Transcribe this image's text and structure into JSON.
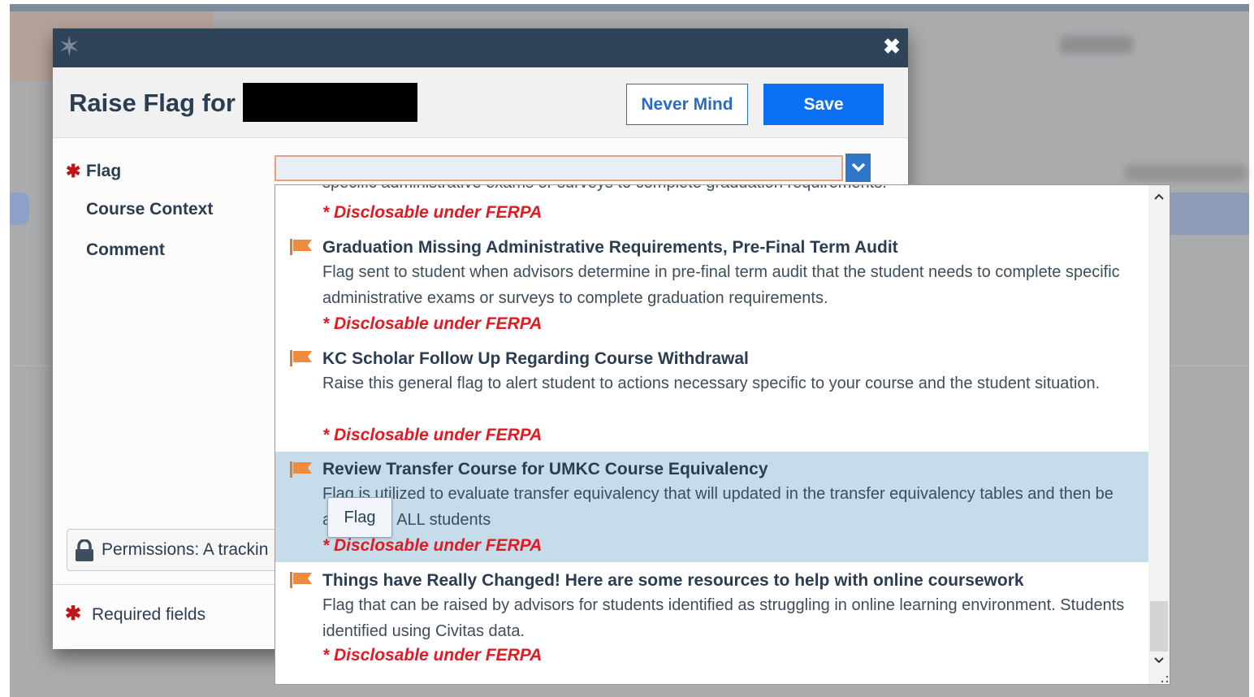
{
  "window": {
    "title_prefix": "Raise Flag for",
    "never_mind_label": "Never Mind",
    "save_label": "Save",
    "close_glyph": "✖",
    "logo_glyph": "✶"
  },
  "form": {
    "flag_label": "Flag",
    "course_context_label": "Course Context",
    "comment_label": "Comment",
    "permissions_label": "Permissions: A trackin",
    "required_text": "Required fields",
    "required_star": "✱"
  },
  "dropdown": {
    "cut_text": "specific administrative exams or surveys to complete graduation requirements.",
    "cut_ferpa": "* Disclosable under FERPA",
    "options": [
      {
        "title": "Graduation Missing Administrative Requirements, Pre-Final Term Audit",
        "desc": "Flag sent to student when advisors determine in pre-final term audit that the student needs to complete specific administrative exams or surveys to complete graduation requirements.",
        "ferpa": "* Disclosable under FERPA",
        "highlighted": false
      },
      {
        "title": "KC Scholar Follow Up Regarding Course Withdrawal",
        "desc": "Raise this general flag to alert student to actions necessary specific to your course and the student situation.",
        "ferpa": "* Disclosable under FERPA",
        "highlighted": false
      },
      {
        "title": "Review Transfer Course for UMKC Course Equivalency",
        "desc": "Flag is utilized to evaluate transfer equivalency that will updated in the transfer equivalency tables and then be applied to ALL students",
        "ferpa": "* Disclosable under FERPA",
        "highlighted": true
      },
      {
        "title": "Things have Really Changed! Here are some resources to help with online coursework",
        "desc": "Flag that can be raised by advisors for students identified as struggling in online learning environment. Students identified using Civitas data.",
        "ferpa": "* Disclosable under FERPA",
        "highlighted": false
      }
    ]
  },
  "tooltip": {
    "text": "Flag"
  },
  "colors": {
    "header_bar": "#2f4359",
    "primary_button": "#0a6ff2",
    "flag_icon": "#f08a3c",
    "ferpa_text": "#e01b24",
    "highlight_row": "#c6dcea"
  }
}
